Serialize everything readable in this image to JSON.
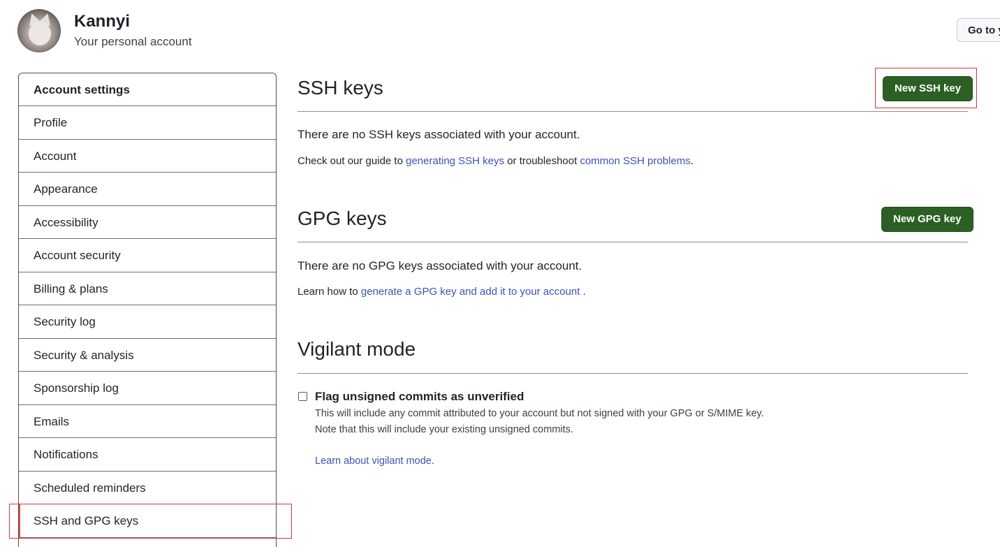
{
  "header": {
    "user_name": "Kannyi",
    "user_subtitle": "Your personal account",
    "goto_button_label": "Go to y"
  },
  "sidebar": {
    "title": "Account settings",
    "items": [
      {
        "label": "Profile"
      },
      {
        "label": "Account"
      },
      {
        "label": "Appearance"
      },
      {
        "label": "Accessibility"
      },
      {
        "label": "Account security"
      },
      {
        "label": "Billing & plans"
      },
      {
        "label": "Security log"
      },
      {
        "label": "Security & analysis"
      },
      {
        "label": "Sponsorship log"
      },
      {
        "label": "Emails"
      },
      {
        "label": "Notifications"
      },
      {
        "label": "Scheduled reminders"
      },
      {
        "label": "SSH and GPG keys"
      }
    ],
    "selected": "SSH and GPG keys"
  },
  "ssh": {
    "title": "SSH keys",
    "button_label": "New SSH key",
    "empty_text": "There are no SSH keys associated with your account.",
    "guide_prefix": "Check out our guide to ",
    "guide_link1": "generating SSH keys",
    "guide_middle": " or troubleshoot ",
    "guide_link2": "common SSH problems",
    "guide_suffix": "."
  },
  "gpg": {
    "title": "GPG keys",
    "button_label": "New GPG key",
    "empty_text": "There are no GPG keys associated with your account.",
    "learn_prefix": "Learn how to ",
    "learn_link": "generate a GPG key and add it to your account",
    "learn_suffix": " ."
  },
  "vigilant": {
    "title": "Vigilant mode",
    "checkbox_label": "Flag unsigned commits as unverified",
    "checked": false,
    "note_line1": "This will include any commit attributed to your account but not signed with your GPG or S/MIME key.",
    "note_line2": "Note that this will include your existing unsigned commits.",
    "learn_link": "Learn about vigilant mode",
    "learn_suffix": "."
  },
  "colors": {
    "primary_button": "#2c5f24",
    "link": "#3f51b5",
    "highlight": "#d9343a"
  }
}
